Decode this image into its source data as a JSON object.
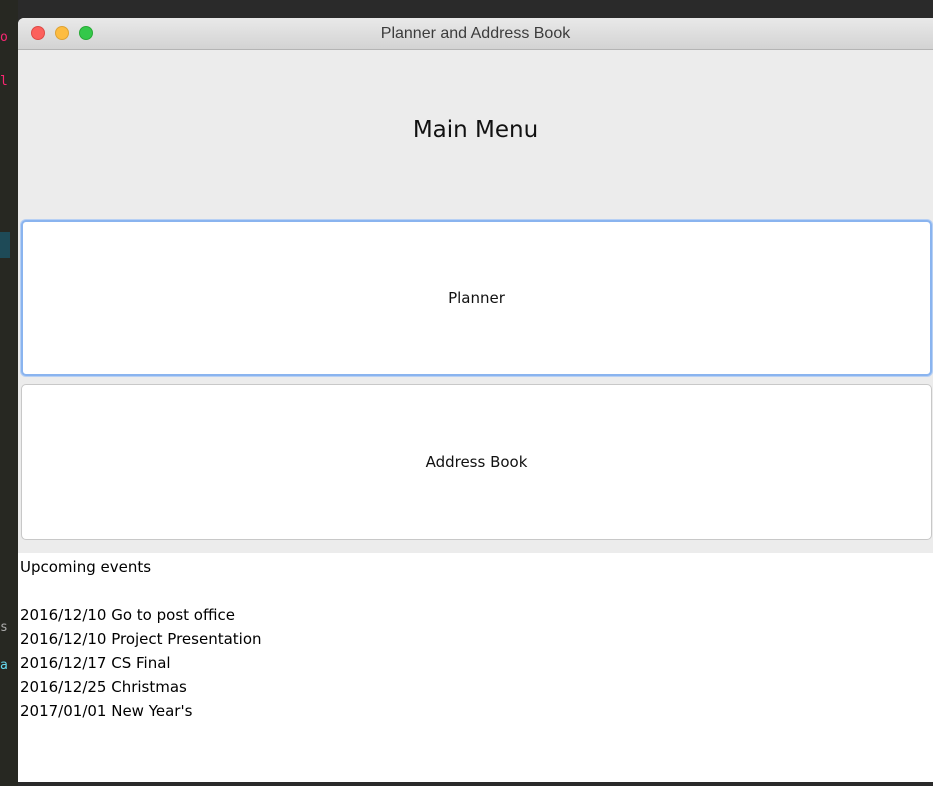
{
  "window": {
    "title": "Planner and Address Book"
  },
  "main": {
    "title": "Main Menu",
    "buttons": [
      {
        "label": "Planner",
        "focused": true
      },
      {
        "label": "Address Book",
        "focused": false
      }
    ]
  },
  "events": {
    "heading": "Upcoming events",
    "items": [
      "2016/12/10 Go to post office",
      "2016/12/10 Project Presentation",
      "2016/12/17 CS Final",
      "2016/12/25 Christmas",
      "2017/01/01 New Year's"
    ]
  },
  "colors": {
    "close": "#fc605c",
    "minimize": "#fdbc40",
    "zoom": "#34c84a",
    "focus_ring": "#8ab4ef"
  }
}
